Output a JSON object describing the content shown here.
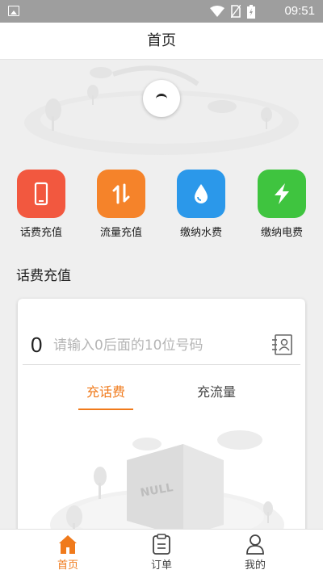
{
  "status_bar": {
    "time": "09:51"
  },
  "header": {
    "title": "首页"
  },
  "services": [
    {
      "label": "话费充值",
      "icon": "phone-icon",
      "color": "#f2583f"
    },
    {
      "label": "流量充值",
      "icon": "arrows-updown-icon",
      "color": "#f5832a"
    },
    {
      "label": "缴纳水费",
      "icon": "water-drop-icon",
      "color": "#2b98ea"
    },
    {
      "label": "缴纳电费",
      "icon": "lightning-icon",
      "color": "#3fc43f"
    }
  ],
  "recharge": {
    "section_title": "话费充值",
    "prefix": "0",
    "placeholder": "请输入0后面的10位号码",
    "tabs": [
      {
        "label": "充话费",
        "active": true
      },
      {
        "label": "充流量",
        "active": false
      }
    ],
    "empty_art_text": "NULL"
  },
  "bottom_nav": [
    {
      "label": "首页",
      "icon": "home-icon",
      "active": true
    },
    {
      "label": "订单",
      "icon": "order-icon",
      "active": false
    },
    {
      "label": "我的",
      "icon": "profile-icon",
      "active": false
    }
  ],
  "colors": {
    "accent": "#f07a1b",
    "nav_inactive": "#444444"
  }
}
